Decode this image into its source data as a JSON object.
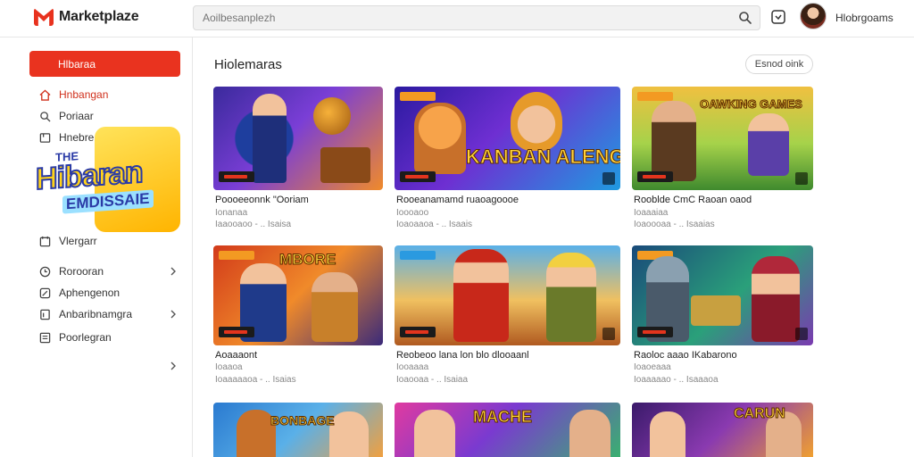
{
  "app": {
    "name": "Marketplaze"
  },
  "search": {
    "placeholder": "Aoilbesanplezh"
  },
  "user": {
    "name": "Hlobrgoams"
  },
  "sidebar": {
    "primary": "Hlbaraa",
    "items": [
      {
        "label": "Hnbangan",
        "icon": "home-icon"
      },
      {
        "label": "Poriaar",
        "icon": "search-icon"
      },
      {
        "label": "Hnebre",
        "icon": "store-icon"
      },
      {
        "label": "Vlergarr",
        "icon": "calendar-icon"
      },
      {
        "label": "Rorooran",
        "icon": "clock-icon"
      },
      {
        "label": "Aphengenon",
        "icon": "edit-icon"
      },
      {
        "label": "Anbaribnamgra",
        "icon": "document-icon"
      },
      {
        "label": "Poorlegran",
        "icon": "list-icon"
      }
    ],
    "promo": {
      "top": "THE",
      "title": "Hibaran",
      "sub": "EMDISSAIE"
    }
  },
  "main": {
    "title": "Hiolemaras",
    "filter_label": "Esnod oink",
    "cards": [
      {
        "title": "Poooeeonnk \"Ooriam",
        "meta1": "Ionanaa",
        "meta2": "Iaaooaoo - .. Isaisa",
        "art": "",
        "badge": true,
        "tag": false
      },
      {
        "title": "Rooeanamamd ruaoagoooe",
        "meta1": "Ioooaoo",
        "meta2": "Ioaoaaoa - .. Isaais",
        "art": "KANBAN ALENGADS",
        "badge": true,
        "tag": true
      },
      {
        "title": "Rooblde CmC Raoan oaod",
        "meta1": "Ioaaaiaa",
        "meta2": "Ioaoooaa - .. Isaaias",
        "art": "OAWKING GAMES",
        "badge": true,
        "tag": true
      },
      {
        "title": "Aoaaaont",
        "meta1": "Ioaaoa",
        "meta2": "Ioaaaaaoa - .. Isaias",
        "art": "MBORE",
        "badge": true,
        "tag": true
      },
      {
        "title": "Reobeoo lana lon blo dlooaanl",
        "meta1": "Iooaaaa",
        "meta2": "Ioaooaa - .. Isaiaa",
        "art": "",
        "badge": true,
        "tag": true
      },
      {
        "title": "Raoloc aaao IKabarono",
        "meta1": "Ioaoeaaa",
        "meta2": "Ioaaaaao - .. Isaaaoa",
        "art": "",
        "badge": true,
        "tag": true
      },
      {
        "title": "",
        "meta1": "",
        "meta2": "",
        "art": "BONBAGE",
        "badge": false,
        "tag": false
      },
      {
        "title": "",
        "meta1": "",
        "meta2": "",
        "art": "MACHE",
        "badge": false,
        "tag": false
      },
      {
        "title": "",
        "meta1": "",
        "meta2": "",
        "art": "CARUN",
        "badge": false,
        "tag": false
      }
    ]
  },
  "colors": {
    "accent": "#e9331f",
    "text": "#222222",
    "muted": "#888888"
  }
}
